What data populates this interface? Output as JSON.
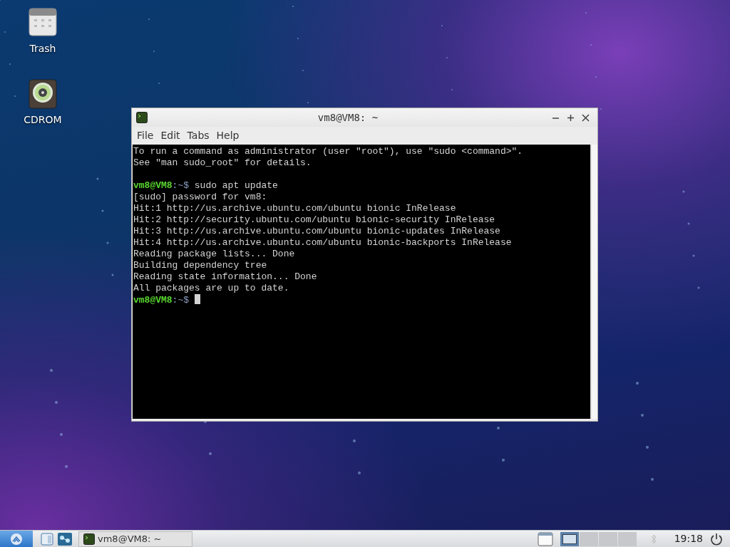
{
  "desktop_icons": [
    {
      "kind": "trash",
      "label": "Trash"
    },
    {
      "kind": "cdrom",
      "label": "CDROM"
    }
  ],
  "window": {
    "title": "vm8@VM8: ~",
    "menu": [
      "File",
      "Edit",
      "Tabs",
      "Help"
    ],
    "terminal_lines": [
      {
        "kind": "text",
        "text": "To run a command as administrator (user \"root\"), use \"sudo <command>\"."
      },
      {
        "kind": "text",
        "text": "See \"man sudo_root\" for details."
      },
      {
        "kind": "blank"
      },
      {
        "kind": "prompt",
        "user": "vm8@VM8",
        "path": ":~$",
        "command": "sudo apt update",
        "cursor": false
      },
      {
        "kind": "text",
        "text": "[sudo] password for vm8:"
      },
      {
        "kind": "text",
        "text": "Hit:1 http://us.archive.ubuntu.com/ubuntu bionic InRelease"
      },
      {
        "kind": "text",
        "text": "Hit:2 http://security.ubuntu.com/ubuntu bionic-security InRelease"
      },
      {
        "kind": "text",
        "text": "Hit:3 http://us.archive.ubuntu.com/ubuntu bionic-updates InRelease"
      },
      {
        "kind": "text",
        "text": "Hit:4 http://us.archive.ubuntu.com/ubuntu bionic-backports InRelease"
      },
      {
        "kind": "text",
        "text": "Reading package lists... Done"
      },
      {
        "kind": "text",
        "text": "Building dependency tree"
      },
      {
        "kind": "text",
        "text": "Reading state information... Done"
      },
      {
        "kind": "text",
        "text": "All packages are up to date."
      },
      {
        "kind": "prompt",
        "user": "vm8@VM8",
        "path": ":~$",
        "cursor": true
      }
    ]
  },
  "taskbar": {
    "tasks": [
      {
        "label": "vm8@VM8: ~",
        "selected": false
      }
    ],
    "workspaces": [
      {
        "selected": true
      },
      {
        "selected": false
      },
      {
        "selected": false
      },
      {
        "selected": false
      }
    ],
    "clock": "19:18"
  }
}
